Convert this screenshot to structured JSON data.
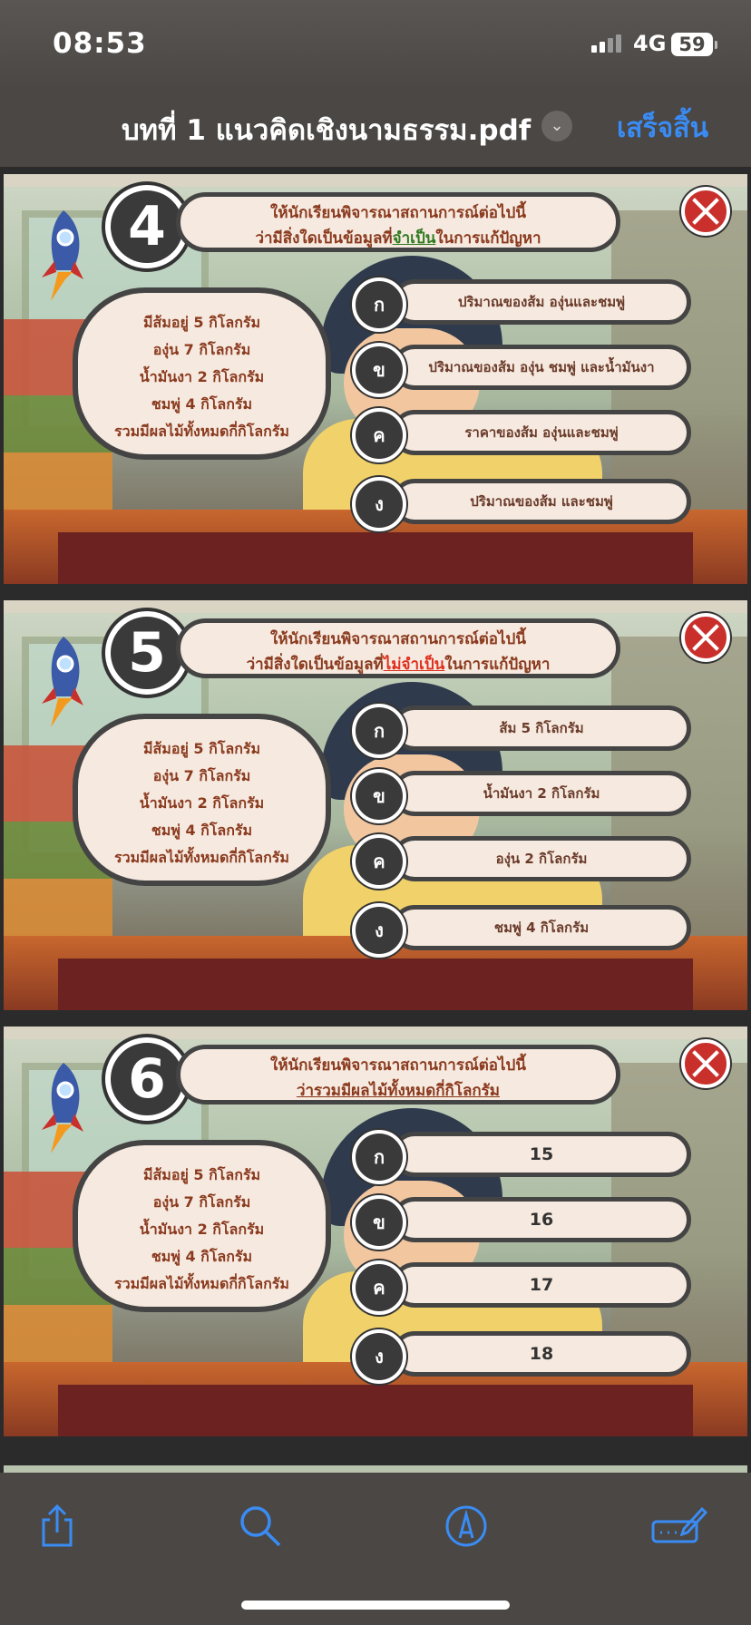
{
  "status_bar": {
    "time": "08:53",
    "network": "4G",
    "battery": "59"
  },
  "nav": {
    "title": "บทที่ 1 แนวคิดเชิงนามธรรม.pdf",
    "done": "เสร็จสิ้น"
  },
  "info_lines": [
    "มีส้มอยู่ 5 กิโลกรัม",
    "องุ่น 7 กิโลกรัม",
    "น้ำมันงา 2 กิโลกรัม",
    "ชมพู่ 4 กิโลกรัม",
    "รวมมีผลไม้ทั้งหมดกี่กิโลกรัม"
  ],
  "slides": [
    {
      "number": "4",
      "prompt_line1": "ให้นักเรียนพิจารณาสถานการณ์ต่อไปนี้",
      "prompt_pre": "ว่ามีสิ่งใดเป็นข้อมูลที่",
      "prompt_highlight": "จำเป็น",
      "prompt_post": "ในการแก้ปัญหา",
      "options": [
        {
          "letter": "ก",
          "text": "ปริมาณของส้ม องุ่นและชมพู่"
        },
        {
          "letter": "ข",
          "text": "ปริมาณของส้ม องุ่น ชมพู่ และน้ำมันงา"
        },
        {
          "letter": "ค",
          "text": "ราคาของส้ม องุ่นและชมพู่"
        },
        {
          "letter": "ง",
          "text": "ปริมาณของส้ม และชมพู่"
        }
      ]
    },
    {
      "number": "5",
      "prompt_line1": "ให้นักเรียนพิจารณาสถานการณ์ต่อไปนี้",
      "prompt_pre": "ว่ามีสิ่งใดเป็นข้อมูลที่",
      "prompt_highlight": "ไม่จำเป็น",
      "prompt_post": "ในการแก้ปัญหา",
      "options": [
        {
          "letter": "ก",
          "text": "ส้ม 5 กิโลกรัม"
        },
        {
          "letter": "ข",
          "text": "น้ำมันงา 2 กิโลกรัม"
        },
        {
          "letter": "ค",
          "text": "องุ่น 2 กิโลกรัม"
        },
        {
          "letter": "ง",
          "text": "ชมพู่ 4 กิโลกรัม"
        }
      ]
    },
    {
      "number": "6",
      "prompt_line1": "ให้นักเรียนพิจารณาสถานการณ์ต่อไปนี้",
      "prompt_pre": "",
      "prompt_highlight": "ว่ารวมมีผลไม้ทั้งหมดกี่กิโลกรัม",
      "prompt_post": "",
      "options": [
        {
          "letter": "ก",
          "text": "15"
        },
        {
          "letter": "ข",
          "text": "16"
        },
        {
          "letter": "ค",
          "text": "17"
        },
        {
          "letter": "ง",
          "text": "18"
        }
      ]
    }
  ],
  "colors": {
    "accent": "#3a8cf4",
    "bar": "#4a4744",
    "close": "#c9302c"
  },
  "toolbar": {
    "icons": [
      "share-icon",
      "search-icon",
      "markup-icon",
      "signature-icon"
    ]
  }
}
